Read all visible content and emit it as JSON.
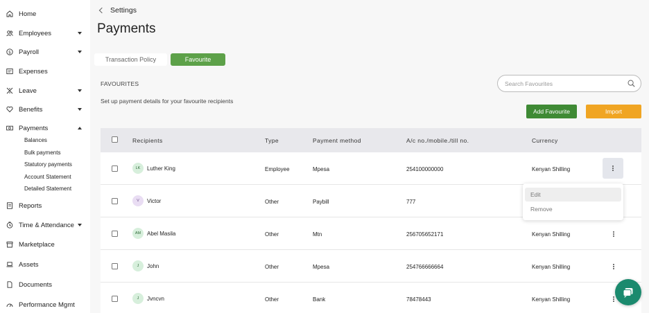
{
  "sidebar": {
    "items": [
      {
        "label": "Home",
        "icon": "home-icon"
      },
      {
        "label": "Employees",
        "icon": "users-icon"
      },
      {
        "label": "Payroll",
        "icon": "money-circle-icon"
      },
      {
        "label": "Expenses",
        "icon": "receipt-icon"
      },
      {
        "label": "Leave",
        "icon": "leave-icon"
      },
      {
        "label": "Benefits",
        "icon": "heart-icon"
      },
      {
        "label": "Payments",
        "icon": "cash-icon"
      },
      {
        "label": "Reports",
        "icon": "report-icon"
      },
      {
        "label": "Time & Attendance",
        "icon": "clock-icon"
      },
      {
        "label": "Marketplace",
        "icon": "store-icon"
      },
      {
        "label": "Assets",
        "icon": "laptop-icon"
      },
      {
        "label": "Documents",
        "icon": "document-icon"
      },
      {
        "label": "Performance Mgmt",
        "icon": "gauge-icon"
      }
    ],
    "payments_sub": [
      "Balances",
      "Bulk payments",
      "Statutory payments",
      "Account Statement",
      "Detailed Statement"
    ]
  },
  "breadcrumb": {
    "label": "Settings"
  },
  "page": {
    "title": "Payments"
  },
  "tabs": [
    {
      "label": "Transaction Policy"
    },
    {
      "label": "Favourite"
    }
  ],
  "section": {
    "title": "FAVOURITES",
    "description": "Set up payment details for your favourite recipients"
  },
  "search": {
    "placeholder": "Search Favourites"
  },
  "actions": {
    "add": "Add Favourite",
    "import": "Import"
  },
  "table": {
    "headers": [
      "Recipients",
      "Type",
      "Payment method",
      "A/c no./mobile./till no.",
      "Currency"
    ],
    "rows": [
      {
        "initials": "LK",
        "name": "Luther King",
        "type": "Employee",
        "method": "Mpesa",
        "account": "254100000000",
        "currency": "Kenyan Shilling"
      },
      {
        "initials": "V",
        "name": "Victor",
        "type": "Other",
        "method": "Paybill",
        "account": "777",
        "currency": ""
      },
      {
        "initials": "AM",
        "name": "Abel Masila",
        "type": "Other",
        "method": "Mtn",
        "account": "256705652171",
        "currency": "Kenyan Shilling"
      },
      {
        "initials": "J",
        "name": "John",
        "type": "Other",
        "method": "Mpesa",
        "account": "254766666664",
        "currency": "Kenyan Shilling"
      },
      {
        "initials": "J",
        "name": "Jvncvn",
        "type": "Other",
        "method": "Bank",
        "account": "78478443",
        "currency": "Kenyan Shilling"
      }
    ]
  },
  "row_menu": {
    "edit": "Edit",
    "remove": "Remove"
  },
  "colors": {
    "accent_green": "#5da149",
    "add_button": "#3f8a35",
    "import_button": "#f0a523",
    "chat": "#1b8a6e"
  }
}
